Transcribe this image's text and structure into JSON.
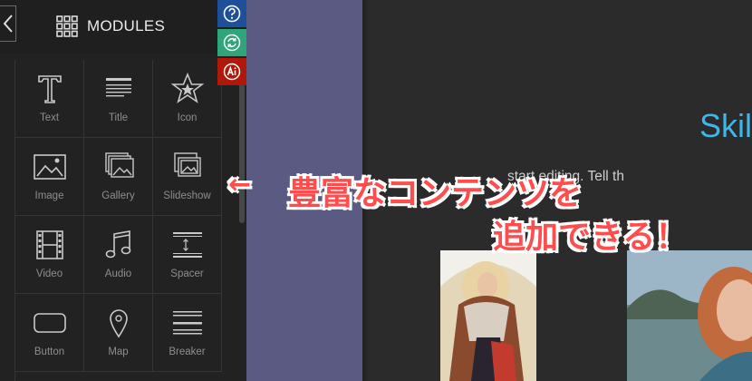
{
  "panel": {
    "title": "MODULES",
    "modules": [
      {
        "label": "Text",
        "icon": "text-icon"
      },
      {
        "label": "Title",
        "icon": "title-icon"
      },
      {
        "label": "Icon",
        "icon": "star-icon"
      },
      {
        "label": "Image",
        "icon": "image-icon"
      },
      {
        "label": "Gallery",
        "icon": "gallery-icon"
      },
      {
        "label": "Slideshow",
        "icon": "slideshow-icon"
      },
      {
        "label": "Video",
        "icon": "film-icon"
      },
      {
        "label": "Audio",
        "icon": "music-note-icon"
      },
      {
        "label": "Spacer",
        "icon": "spacer-icon"
      },
      {
        "label": "Button",
        "icon": "button-icon"
      },
      {
        "label": "Map",
        "icon": "map-pin-icon"
      },
      {
        "label": "Breaker",
        "icon": "breaker-icon"
      }
    ]
  },
  "side_buttons": [
    {
      "icon": "help-icon",
      "color": "#1e4f99"
    },
    {
      "icon": "refresh-icon",
      "color": "#2ea57a"
    },
    {
      "icon": "ai-icon",
      "color": "#b0180a"
    }
  ],
  "canvas": {
    "title": "Skil",
    "text": "start editing. Tell th"
  },
  "annotation": {
    "arrow": "←",
    "line1": "豊富なコンテンツを",
    "line2": "追加できる！"
  },
  "colors": {
    "panel_bg": "#222222",
    "strip": "#5a5a82",
    "accent_title": "#3fb6e6",
    "annotation": "#ff4d4d"
  }
}
